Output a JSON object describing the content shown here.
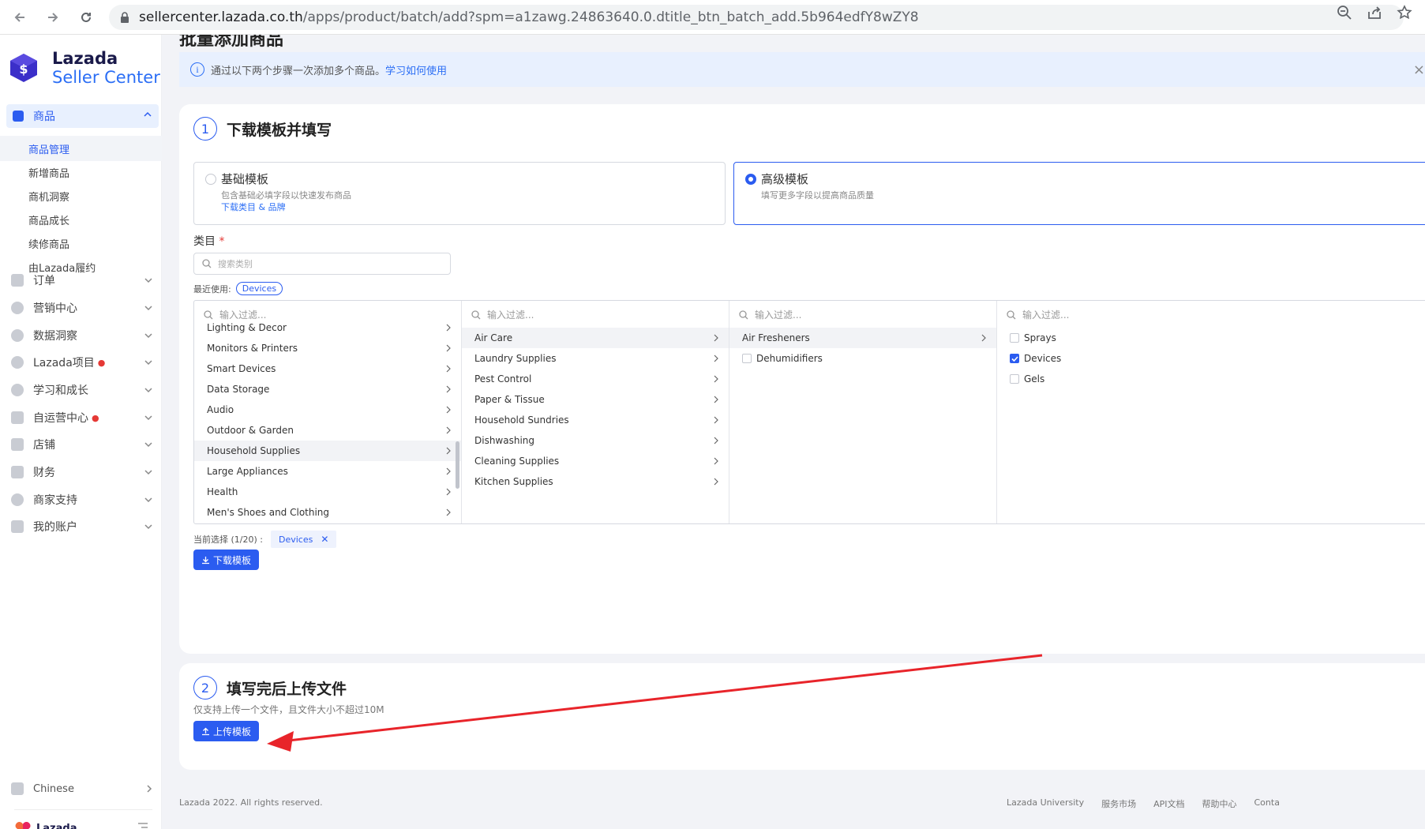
{
  "browser": {
    "url_host": "sellercenter.lazada.co.th",
    "url_path": "/apps/product/batch/add?spm=a1zawg.24863640.0.dtitle_btn_batch_add.5b964edfY8wZY8"
  },
  "brand": {
    "line1": "Lazada",
    "line2": "Seller Center",
    "mini": "Lazada"
  },
  "sidebar": {
    "section": "商品",
    "subitems": [
      "商品管理",
      "新增商品",
      "商机洞察",
      "商品成长",
      "续修商品",
      "由Lazada履约"
    ],
    "items": [
      {
        "label": "订单"
      },
      {
        "label": "营销中心"
      },
      {
        "label": "数据洞察"
      },
      {
        "label": "Lazada项目"
      },
      {
        "label": "学习和成长"
      },
      {
        "label": "自运营中心"
      },
      {
        "label": "店铺"
      },
      {
        "label": "财务"
      },
      {
        "label": "商家支持"
      },
      {
        "label": "我的账户"
      }
    ],
    "language": "Chinese"
  },
  "page": {
    "title": "批量添加商品",
    "banner_text": "通过以下两个步骤一次添加多个商品。",
    "banner_link": "学习如何使用"
  },
  "step1": {
    "number": "1",
    "title": "下载模板并填写",
    "basic": {
      "title": "基础模板",
      "desc": "包含基础必填字段以快速发布商品",
      "link": "下载类目 & 品牌",
      "selected": false
    },
    "advanced": {
      "title": "高级模板",
      "desc": "填写更多字段以提高商品质量",
      "selected": true
    },
    "category_label": "类目",
    "required_mark": "*",
    "search_placeholder": "搜索类别",
    "recent_label": "最近使用:",
    "recent_tag": "Devices",
    "filter_placeholder": "输入过滤...",
    "col1": [
      "Lighting & Decor",
      "Monitors & Printers",
      "Smart Devices",
      "Data Storage",
      "Audio",
      "Outdoor & Garden",
      "Household Supplies",
      "Large Appliances",
      "Health",
      "Men's Shoes and Clothing"
    ],
    "col2": [
      "Air Care",
      "Laundry Supplies",
      "Pest Control",
      "Paper & Tissue",
      "Household Sundries",
      "Dishwashing",
      "Cleaning Supplies",
      "Kitchen Supplies"
    ],
    "col3": [
      "Air Fresheners",
      "Dehumidifiers"
    ],
    "col4": [
      {
        "label": "Sprays",
        "checked": false
      },
      {
        "label": "Devices",
        "checked": true
      },
      {
        "label": "Gels",
        "checked": false
      }
    ],
    "current_label": "当前选择 (1/20) :",
    "current_chip": "Devices",
    "download_btn": "下载模板"
  },
  "step2": {
    "number": "2",
    "title": "填写完后上传文件",
    "note": "仅支持上传一个文件，且文件大小不超过10M",
    "upload_btn": "上传模板"
  },
  "footer": {
    "copyright": "Lazada 2022. All rights reserved.",
    "links": [
      "Lazada University",
      "服务市场",
      "API文档",
      "帮助中心",
      "Conta"
    ]
  },
  "colors": {
    "primary": "#2b5cf0",
    "annotation": "#e8242a"
  }
}
